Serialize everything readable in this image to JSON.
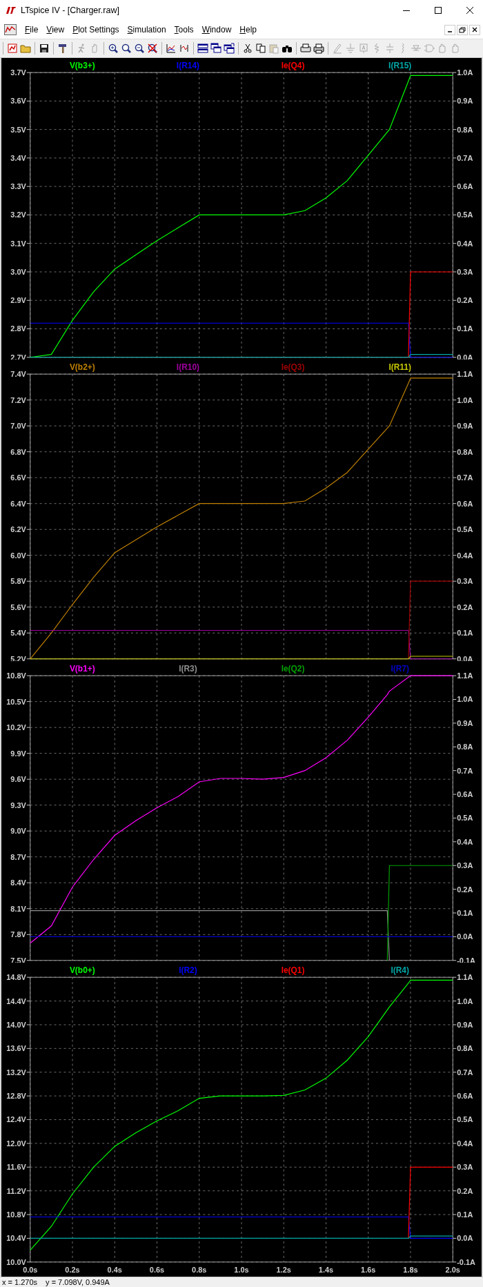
{
  "window": {
    "title": "LTspice IV - [Charger.raw]"
  },
  "menu": [
    "File",
    "View",
    "Plot Settings",
    "Simulation",
    "Tools",
    "Window",
    "Help"
  ],
  "toolbar": [
    [
      {
        "disabled": false
      },
      {
        "disabled": false
      }
    ],
    [
      {
        "disabled": false
      }
    ],
    [
      {
        "disabled": false
      }
    ],
    [
      {
        "disabled": true
      },
      {
        "disabled": true
      }
    ],
    [
      {
        "disabled": false
      },
      {
        "disabled": false
      },
      {
        "disabled": false
      },
      {
        "disabled": false
      }
    ],
    [
      {
        "disabled": false
      },
      {
        "disabled": false
      }
    ],
    [
      {
        "disabled": false
      },
      {
        "disabled": false
      },
      {
        "disabled": false
      }
    ],
    [
      {
        "disabled": false
      },
      {
        "disabled": false
      },
      {
        "disabled": true
      },
      {
        "disabled": false
      }
    ],
    [
      {
        "disabled": false
      },
      {
        "disabled": false
      }
    ],
    [
      {
        "disabled": true
      },
      {
        "disabled": true
      },
      {
        "disabled": true
      },
      {
        "disabled": true
      },
      {
        "disabled": true
      },
      {
        "disabled": true
      },
      {
        "disabled": true
      },
      {
        "disabled": true
      },
      {
        "disabled": true
      },
      {
        "disabled": true
      }
    ]
  ],
  "panes": [
    {
      "chart_data": {
        "type": "line",
        "grid": true,
        "x": [
          0,
          0.1,
          0.2,
          0.3,
          0.4,
          0.5,
          0.6,
          0.7,
          0.8,
          0.9,
          1.0,
          1.1,
          1.2,
          1.3,
          1.4,
          1.5,
          1.6,
          1.7,
          1.79,
          1.8,
          1.9,
          2.0
        ],
        "xlim": [
          0,
          2.0
        ],
        "ylim": [
          2.7,
          3.7
        ],
        "yticks": [
          {
            "value": 2.7,
            "label": "2.7V"
          },
          {
            "value": 2.8,
            "label": "2.8V"
          },
          {
            "value": 2.9,
            "label": "2.9V"
          },
          {
            "value": 3.0,
            "label": "3.0V"
          },
          {
            "value": 3.1,
            "label": "3.1V"
          },
          {
            "value": 3.2,
            "label": "3.2V"
          },
          {
            "value": 3.3,
            "label": "3.3V"
          },
          {
            "value": 3.4,
            "label": "3.4V"
          },
          {
            "value": 3.5,
            "label": "3.5V"
          },
          {
            "value": 3.6,
            "label": "3.6V"
          },
          {
            "value": 3.7,
            "label": "3.7V"
          }
        ],
        "y2lim": [
          0,
          1.0
        ],
        "y2ticks": [
          {
            "value": 0,
            "label": "0.0A"
          },
          {
            "value": 0.1,
            "label": "0.1A"
          },
          {
            "value": 0.2,
            "label": "0.2A"
          },
          {
            "value": 0.3,
            "label": "0.3A"
          },
          {
            "value": 0.4,
            "label": "0.4A"
          },
          {
            "value": 0.5,
            "label": "0.5A"
          },
          {
            "value": 0.6,
            "label": "0.6A"
          },
          {
            "value": 0.7,
            "label": "0.7A"
          },
          {
            "value": 0.8,
            "label": "0.8A"
          },
          {
            "value": 0.9,
            "label": "0.9A"
          },
          {
            "value": 1.0,
            "label": "1.0A"
          }
        ],
        "series": [
          {
            "name": "V(b3+)",
            "color": "#00ff00",
            "values": [
              2.7,
              2.71,
              2.83,
              2.93,
              3.01,
              3.06,
              3.11,
              3.155,
              3.2,
              3.2,
              3.2,
              3.2,
              3.2,
              3.215,
              3.26,
              3.32,
              3.41,
              3.5,
              3.67,
              3.69,
              3.69,
              3.69
            ]
          },
          {
            "name": "I(R14)",
            "color": "#0000ff",
            "axis": "y2",
            "values": [
              0.12,
              0.12,
              0.12,
              0.12,
              0.12,
              0.12,
              0.12,
              0.12,
              0.12,
              0.12,
              0.12,
              0.12,
              0.12,
              0.12,
              0.12,
              0.12,
              0.12,
              0.12,
              0.12,
              0,
              0,
              0
            ]
          },
          {
            "name": "Ie(Q4)",
            "color": "#ff0000",
            "axis": "y2",
            "values": [
              null,
              null,
              null,
              null,
              null,
              null,
              null,
              null,
              null,
              null,
              null,
              null,
              null,
              null,
              null,
              null,
              null,
              null,
              0,
              0.3,
              0.3,
              0.3
            ]
          },
          {
            "name": "I(R15)",
            "color": "#00a8a8",
            "axis": "y2",
            "values": [
              0,
              0,
              0,
              0,
              0,
              0,
              0,
              0,
              0,
              0,
              0,
              0,
              0,
              0,
              0,
              0,
              0,
              0,
              0,
              0.01,
              0.01,
              0.01
            ]
          }
        ]
      }
    },
    {
      "chart_data": {
        "type": "line",
        "grid": true,
        "x": [
          0,
          0.1,
          0.2,
          0.3,
          0.4,
          0.5,
          0.6,
          0.7,
          0.8,
          0.9,
          1.0,
          1.1,
          1.2,
          1.3,
          1.4,
          1.5,
          1.6,
          1.7,
          1.79,
          1.8,
          1.9,
          2.0
        ],
        "xlim": [
          0,
          2.0
        ],
        "ylim": [
          5.2,
          7.4
        ],
        "yticks": [
          {
            "value": 5.2,
            "label": "5.2V"
          },
          {
            "value": 5.4,
            "label": "5.4V"
          },
          {
            "value": 5.6,
            "label": "5.6V"
          },
          {
            "value": 5.8,
            "label": "5.8V"
          },
          {
            "value": 6.0,
            "label": "6.0V"
          },
          {
            "value": 6.2,
            "label": "6.2V"
          },
          {
            "value": 6.4,
            "label": "6.4V"
          },
          {
            "value": 6.6,
            "label": "6.6V"
          },
          {
            "value": 6.8,
            "label": "6.8V"
          },
          {
            "value": 7.0,
            "label": "7.0V"
          },
          {
            "value": 7.2,
            "label": "7.2V"
          },
          {
            "value": 7.4,
            "label": "7.4V"
          }
        ],
        "y2lim": [
          0,
          1.1
        ],
        "y2ticks": [
          {
            "value": 0,
            "label": "0.0A"
          },
          {
            "value": 0.1,
            "label": "0.1A"
          },
          {
            "value": 0.2,
            "label": "0.2A"
          },
          {
            "value": 0.3,
            "label": "0.3A"
          },
          {
            "value": 0.4,
            "label": "0.4A"
          },
          {
            "value": 0.5,
            "label": "0.5A"
          },
          {
            "value": 0.6,
            "label": "0.6A"
          },
          {
            "value": 0.7,
            "label": "0.7A"
          },
          {
            "value": 0.8,
            "label": "0.8A"
          },
          {
            "value": 0.9,
            "label": "0.9A"
          },
          {
            "value": 1.0,
            "label": "1.0A"
          },
          {
            "value": 1.1,
            "label": "1.1A"
          }
        ],
        "series": [
          {
            "name": "V(b2+)",
            "color": "#c08000",
            "values": [
              5.2,
              5.4,
              5.62,
              5.83,
              6.02,
              6.12,
              6.22,
              6.31,
              6.4,
              6.4,
              6.4,
              6.4,
              6.4,
              6.42,
              6.52,
              6.64,
              6.82,
              7.0,
              7.33,
              7.37,
              7.37,
              7.37
            ]
          },
          {
            "name": "I(R10)",
            "color": "#a000a0",
            "axis": "y2",
            "values": [
              0.11,
              0.11,
              0.11,
              0.11,
              0.11,
              0.11,
              0.11,
              0.11,
              0.11,
              0.11,
              0.11,
              0.11,
              0.11,
              0.11,
              0.11,
              0.11,
              0.11,
              0.11,
              0.11,
              0,
              0,
              0
            ]
          },
          {
            "name": "Ie(Q3)",
            "color": "#a00000",
            "axis": "y2",
            "values": [
              null,
              null,
              null,
              null,
              null,
              null,
              null,
              null,
              null,
              null,
              null,
              null,
              null,
              null,
              null,
              null,
              null,
              null,
              0,
              0.3,
              0.3,
              0.3
            ]
          },
          {
            "name": "I(R11)",
            "color": "#c8c800",
            "axis": "y2",
            "values": [
              0,
              0,
              0,
              0,
              0,
              0,
              0,
              0,
              0,
              0,
              0,
              0,
              0,
              0,
              0,
              0,
              0,
              0,
              0,
              0.01,
              0.01,
              0.01
            ]
          }
        ]
      }
    },
    {
      "chart_data": {
        "type": "line",
        "grid": true,
        "x": [
          0,
          0.1,
          0.2,
          0.3,
          0.4,
          0.5,
          0.6,
          0.7,
          0.8,
          0.9,
          1.0,
          1.1,
          1.2,
          1.3,
          1.4,
          1.5,
          1.6,
          1.69,
          1.7,
          1.8,
          1.9,
          2.0
        ],
        "xlim": [
          0,
          2.0
        ],
        "ylim": [
          7.5,
          10.8
        ],
        "yticks": [
          {
            "value": 7.5,
            "label": "7.5V"
          },
          {
            "value": 7.8,
            "label": "7.8V"
          },
          {
            "value": 8.1,
            "label": "8.1V"
          },
          {
            "value": 8.4,
            "label": "8.4V"
          },
          {
            "value": 8.7,
            "label": "8.7V"
          },
          {
            "value": 9.0,
            "label": "9.0V"
          },
          {
            "value": 9.3,
            "label": "9.3V"
          },
          {
            "value": 9.6,
            "label": "9.6V"
          },
          {
            "value": 9.9,
            "label": "9.9V"
          },
          {
            "value": 10.2,
            "label": "10.2V"
          },
          {
            "value": 10.5,
            "label": "10.5V"
          },
          {
            "value": 10.8,
            "label": "10.8V"
          }
        ],
        "y2lim": [
          -0.1,
          1.1
        ],
        "y2ticks": [
          {
            "value": -0.1,
            "label": "-0.1A"
          },
          {
            "value": 0,
            "label": "0.0A"
          },
          {
            "value": 0.1,
            "label": "0.1A"
          },
          {
            "value": 0.2,
            "label": "0.2A"
          },
          {
            "value": 0.3,
            "label": "0.3A"
          },
          {
            "value": 0.4,
            "label": "0.4A"
          },
          {
            "value": 0.5,
            "label": "0.5A"
          },
          {
            "value": 0.6,
            "label": "0.6A"
          },
          {
            "value": 0.7,
            "label": "0.7A"
          },
          {
            "value": 0.8,
            "label": "0.8A"
          },
          {
            "value": 0.9,
            "label": "0.9A"
          },
          {
            "value": 1.0,
            "label": "1.0A"
          },
          {
            "value": 1.1,
            "label": "1.1A"
          }
        ],
        "series": [
          {
            "name": "V(b1+)",
            "color": "#ff00ff",
            "values": [
              7.7,
              7.9,
              8.35,
              8.67,
              8.95,
              9.12,
              9.27,
              9.4,
              9.57,
              9.61,
              9.61,
              9.6,
              9.62,
              9.7,
              9.85,
              10.05,
              10.32,
              10.58,
              10.62,
              10.8,
              10.8,
              10.8
            ]
          },
          {
            "name": "I(R3)",
            "color": "#909090",
            "axis": "y2",
            "values": [
              0.11,
              0.11,
              0.11,
              0.11,
              0.11,
              0.11,
              0.11,
              0.11,
              0.11,
              0.11,
              0.11,
              0.11,
              0.11,
              0.11,
              0.11,
              0.11,
              0.11,
              0.11,
              -0.1,
              null,
              null,
              null
            ]
          },
          {
            "name": "Ie(Q2)",
            "color": "#00a000",
            "axis": "y2",
            "values": [
              null,
              null,
              null,
              null,
              null,
              null,
              null,
              null,
              null,
              null,
              null,
              null,
              null,
              null,
              null,
              null,
              null,
              -0.1,
              0.3,
              0.3,
              0.3,
              0.3
            ]
          },
          {
            "name": "I(R7)",
            "color": "#0000c8",
            "axis": "y2",
            "values": [
              0,
              0,
              0,
              0,
              0,
              0,
              0,
              0,
              0,
              0,
              0,
              0,
              0,
              0,
              0,
              0,
              0,
              0,
              0,
              0,
              0,
              0
            ]
          }
        ]
      }
    },
    {
      "chart_data": {
        "type": "line",
        "grid": true,
        "x": [
          0,
          0.1,
          0.2,
          0.3,
          0.4,
          0.5,
          0.6,
          0.7,
          0.8,
          0.9,
          1.0,
          1.1,
          1.2,
          1.3,
          1.4,
          1.5,
          1.6,
          1.7,
          1.79,
          1.8,
          1.9,
          2.0
        ],
        "xlim": [
          0,
          2.0
        ],
        "xticks": [
          {
            "value": 0,
            "label": "0.0s"
          },
          {
            "value": 0.2,
            "label": "0.2s"
          },
          {
            "value": 0.4,
            "label": "0.4s"
          },
          {
            "value": 0.6,
            "label": "0.6s"
          },
          {
            "value": 0.8,
            "label": "0.8s"
          },
          {
            "value": 1.0,
            "label": "1.0s"
          },
          {
            "value": 1.2,
            "label": "1.2s"
          },
          {
            "value": 1.4,
            "label": "1.4s"
          },
          {
            "value": 1.6,
            "label": "1.6s"
          },
          {
            "value": 1.8,
            "label": "1.8s"
          },
          {
            "value": 2.0,
            "label": "2.0s"
          }
        ],
        "ylim": [
          10.0,
          14.8
        ],
        "yticks": [
          {
            "value": 10.0,
            "label": "10.0V"
          },
          {
            "value": 10.4,
            "label": "10.4V"
          },
          {
            "value": 10.8,
            "label": "10.8V"
          },
          {
            "value": 11.2,
            "label": "11.2V"
          },
          {
            "value": 11.6,
            "label": "11.6V"
          },
          {
            "value": 12.0,
            "label": "12.0V"
          },
          {
            "value": 12.4,
            "label": "12.4V"
          },
          {
            "value": 12.8,
            "label": "12.8V"
          },
          {
            "value": 13.2,
            "label": "13.2V"
          },
          {
            "value": 13.6,
            "label": "13.6V"
          },
          {
            "value": 14.0,
            "label": "14.0V"
          },
          {
            "value": 14.4,
            "label": "14.4V"
          },
          {
            "value": 14.8,
            "label": "14.8V"
          }
        ],
        "y2lim": [
          -0.1,
          1.1
        ],
        "y2ticks": [
          {
            "value": -0.1,
            "label": "-0.1A"
          },
          {
            "value": 0,
            "label": "0.0A"
          },
          {
            "value": 0.1,
            "label": "0.1A"
          },
          {
            "value": 0.2,
            "label": "0.2A"
          },
          {
            "value": 0.3,
            "label": "0.3A"
          },
          {
            "value": 0.4,
            "label": "0.4A"
          },
          {
            "value": 0.5,
            "label": "0.5A"
          },
          {
            "value": 0.6,
            "label": "0.6A"
          },
          {
            "value": 0.7,
            "label": "0.7A"
          },
          {
            "value": 0.8,
            "label": "0.8A"
          },
          {
            "value": 0.9,
            "label": "0.9A"
          },
          {
            "value": 1.0,
            "label": "1.0A"
          },
          {
            "value": 1.1,
            "label": "1.1A"
          }
        ],
        "series": [
          {
            "name": "V(b0+)",
            "color": "#00ff00",
            "values": [
              10.2,
              10.6,
              11.15,
              11.6,
              11.95,
              12.18,
              12.38,
              12.55,
              12.76,
              12.8,
              12.8,
              12.8,
              12.81,
              12.9,
              13.1,
              13.4,
              13.8,
              14.3,
              14.7,
              14.75,
              14.75,
              14.75
            ]
          },
          {
            "name": "I(R2)",
            "color": "#0000ff",
            "axis": "y2",
            "values": [
              0.09,
              0.09,
              0.09,
              0.09,
              0.09,
              0.09,
              0.09,
              0.09,
              0.09,
              0.09,
              0.09,
              0.09,
              0.09,
              0.09,
              0.09,
              0.09,
              0.09,
              0.09,
              0.09,
              0,
              0,
              0
            ]
          },
          {
            "name": "Ie(Q1)",
            "color": "#ff0000",
            "axis": "y2",
            "values": [
              null,
              null,
              null,
              null,
              null,
              null,
              null,
              null,
              null,
              null,
              null,
              null,
              null,
              null,
              null,
              null,
              null,
              null,
              0,
              0.3,
              0.3,
              0.3
            ]
          },
          {
            "name": "I(R4)",
            "color": "#00a8a8",
            "axis": "y2",
            "values": [
              0,
              0,
              0,
              0,
              0,
              0,
              0,
              0,
              0,
              0,
              0,
              0,
              0,
              0,
              0,
              0,
              0,
              0,
              0,
              0.01,
              0.01,
              0.01
            ]
          }
        ]
      }
    }
  ],
  "status_bar": {
    "x": "x = 1.270s",
    "y": "y = 7.098V, 0.949A"
  }
}
